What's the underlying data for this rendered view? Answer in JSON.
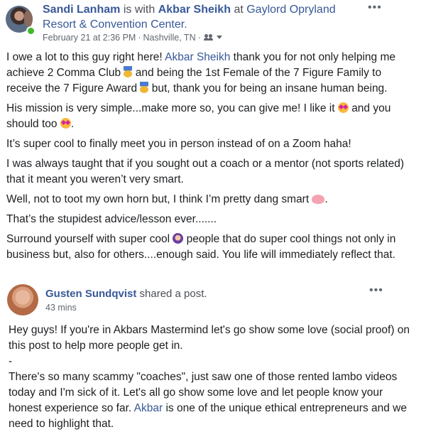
{
  "post": {
    "author": "Sandi Lanham",
    "with_text": "is with",
    "tagged": "Akbar Sheikh",
    "at_text": "at",
    "place": "Gaylord Opryland Resort & Convention Center.",
    "date": "February 21 at 2:36 PM",
    "location": "Nashville, TN",
    "more": "•••",
    "paragraphs": {
      "p1a": "I owe a lot to this guy right here!",
      "p1_mention": "Akbar Sheikh",
      "p1b": "thank you for not only helping me achieve 2 Comma Club",
      "p1c": "and being the 1st Female of the 7 Figure Family to receive the 7 Figure Award",
      "p1d": "but, thank you for being an insane human being.",
      "p2a": "His mission is very simple...make more so, you can give me! I like it",
      "p2b": "and you should too",
      "p2c": ".",
      "p3": "It’s super cool to finally meet you in person instead of on a Zoom haha!",
      "p4": "I was always taught that if you sought out a coach or a mentor (not sports related) that it meant you weren’t very smart.",
      "p5a": "Well, not to toot my own horn but, I think I’m pretty dang smart",
      "p5b": ".",
      "p6": "That’s the stupidest advice/lesson ever.......",
      "p7a": "Surround yourself with super cool",
      "p7b": "people that do super cool things not only in business but, also for others....enough said. You life will immediately reflect that."
    }
  },
  "shared": {
    "author": "Gusten Sundqvist",
    "action": "shared a post.",
    "time": "43 mins",
    "more": "•••",
    "l1": "Hey guys! If you're in Akbars Mastermind let's go show some love (social proof) on this post to help more people get in.",
    "l2": "-",
    "l3a": "There's so many scammy \"coaches\", just saw one of those rented lambo videos today and I'm sick of it. Let's all go show some love and let people know your honest experience so far.",
    "l3_mention": "Akbar",
    "l3b": "is one of the unique ethical entrepreneurs and we need to highlight that."
  },
  "icons": {
    "privacy": "friends-icon",
    "privacy_menu": "chevron-down-icon",
    "medal": "medal-emoji",
    "star_struck": "star-struck-emoji",
    "brain": "brain-emoji",
    "woman": "woman-emoji"
  },
  "colors": {
    "link": "#385898",
    "text": "#1c1e21",
    "meta": "#616770",
    "online": "#42b72a"
  }
}
